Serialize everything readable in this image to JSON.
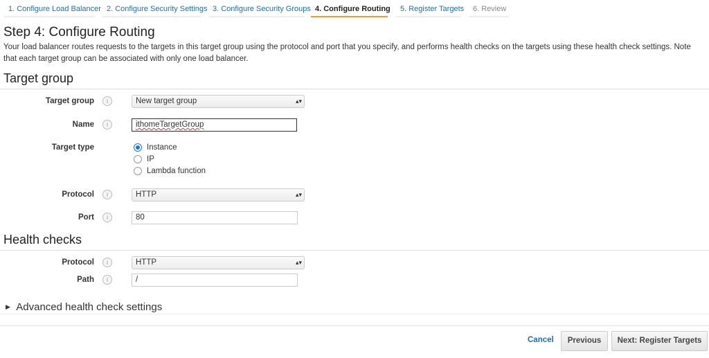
{
  "wizard": {
    "tabs": [
      {
        "label": "1. Configure Load Balancer",
        "state": "done"
      },
      {
        "label": "2. Configure Security Settings",
        "state": "done"
      },
      {
        "label": "3. Configure Security Groups",
        "state": "done"
      },
      {
        "label": "4. Configure Routing",
        "state": "active"
      },
      {
        "label": "5. Register Targets",
        "state": "next"
      },
      {
        "label": "6. Review",
        "state": "disabled"
      }
    ]
  },
  "page": {
    "title": "Step 4: Configure Routing",
    "description": "Your load balancer routes requests to the targets in this target group using the protocol and port that you specify, and performs health checks on the targets using these health check settings. Note that each target group can be associated with only one load balancer."
  },
  "target_group": {
    "heading": "Target group",
    "target_group_label": "Target group",
    "target_group_value": "New target group",
    "name_label": "Name",
    "name_value": "ithomeTargetGroup",
    "target_type_label": "Target type",
    "target_type_options": [
      "Instance",
      "IP",
      "Lambda function"
    ],
    "target_type_selected": "Instance",
    "protocol_label": "Protocol",
    "protocol_value": "HTTP",
    "port_label": "Port",
    "port_value": "80"
  },
  "health_checks": {
    "heading": "Health checks",
    "protocol_label": "Protocol",
    "protocol_value": "HTTP",
    "path_label": "Path",
    "path_value": "/",
    "advanced_label": "Advanced health check settings"
  },
  "footer": {
    "cancel": "Cancel",
    "previous": "Previous",
    "next": "Next: Register Targets"
  },
  "colors": {
    "accent": "#f79a1e",
    "link": "#1f6fb5"
  }
}
